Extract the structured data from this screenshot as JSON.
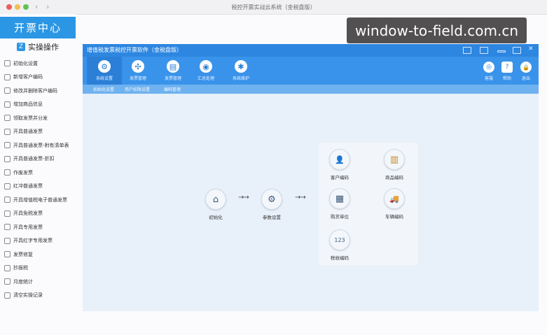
{
  "window": {
    "title": "税控开票实战云系统（金税盘版）",
    "nav_back": "‹",
    "nav_fwd": "›"
  },
  "sidebar": {
    "brand": "开票中心",
    "sub_title": "实操操作",
    "sub_icon": "Z",
    "items": [
      "初始化设置",
      "新增客户编码",
      "修改并删除客户编码",
      "增加商品信息",
      "领取发票并分发",
      "开具普通发票",
      "开具普通发票-附有清单表",
      "开具普通发票-折扣",
      "作废发票",
      "红冲普通发票",
      "开具增值税电子普通发票",
      "开具免税发票",
      "开具专用发票",
      "开具红字专用发票",
      "发票修复",
      "抄报税",
      "月度统计",
      "清空实操记录"
    ]
  },
  "app": {
    "title": "增值税发票税控开票软件（金税盘版）",
    "tools": [
      {
        "label": "系统设置",
        "glyph": "⚙"
      },
      {
        "label": "发票管理",
        "glyph": "✣"
      },
      {
        "label": "发票管理",
        "glyph": "▤"
      },
      {
        "label": "汇总处理",
        "glyph": "◉"
      },
      {
        "label": "系统维护",
        "glyph": "✱"
      }
    ],
    "right_tools": [
      {
        "label": "客服",
        "glyph": "◎"
      },
      {
        "label": "帮助",
        "glyph": "?"
      },
      {
        "label": "退出",
        "glyph": "🔒"
      }
    ],
    "subnav": [
      "初始化设置",
      "用户权限设置",
      "编码管理"
    ],
    "flow": [
      {
        "label": "初始化",
        "glyph": "⌂"
      },
      {
        "label": "参数设置",
        "glyph": "⚙"
      }
    ],
    "panel": [
      {
        "label": "客户编码",
        "glyph": "👤"
      },
      {
        "label": "商品编码",
        "glyph": "▥"
      },
      {
        "label": "购货单位",
        "glyph": "▦"
      },
      {
        "label": "车辆编码",
        "glyph": "🚚"
      },
      {
        "label": "税收编码",
        "glyph": "123"
      }
    ],
    "arrow": "→→"
  },
  "watermark": "window-to-field.com.cn"
}
